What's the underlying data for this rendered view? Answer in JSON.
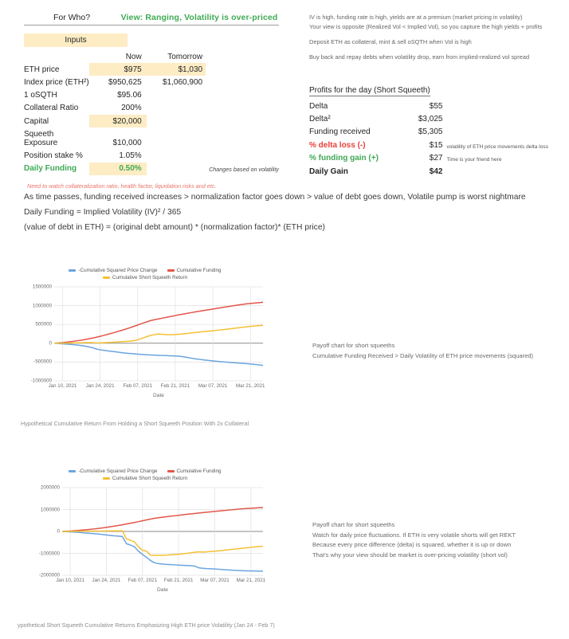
{
  "header": {
    "for_who": "For Who?",
    "view": "View: Ranging, Volatility is over-priced"
  },
  "inputs": {
    "badge": "Inputs",
    "col_now": "Now",
    "col_tomorrow": "Tomorrow",
    "rows": [
      {
        "label": "ETH price",
        "now": "$975",
        "tomorrow": "$1,030",
        "highlight": true
      },
      {
        "label": "Index price (ETH²)",
        "now": "$950,625",
        "tomorrow": "$1,060,900",
        "highlight": false
      },
      {
        "label": "1 oSQTH",
        "now": "$95.06",
        "tomorrow": "",
        "highlight": false
      },
      {
        "label": "Collateral Ratio",
        "now": "200%",
        "tomorrow": "",
        "highlight": false
      },
      {
        "label": "Capital",
        "now": "$20,000",
        "tomorrow": "",
        "highlight": true
      },
      {
        "label": "Squeeth Exposure",
        "now": "$10,000",
        "tomorrow": "",
        "highlight": false
      },
      {
        "label": "Position stake %",
        "now": "1.05%",
        "tomorrow": "",
        "highlight": false
      },
      {
        "label": "Daily Funding",
        "now": "0.50%",
        "tomorrow": "",
        "highlight": true,
        "note": "Changes based on volatility",
        "label_style": "green"
      }
    ],
    "warning": "Need to watch collateralization ratio, health factor, liquidation risks and etc."
  },
  "explainers": [
    "As time passes, funding received increases > normalization factor goes down > value of debt goes down, Volatile pump is worst nightmare",
    "Daily Funding = Implied Volatility (IV)² / 365",
    "(value of debt in ETH) = (original debt amount) * (normalization factor)* (ETH price)"
  ],
  "right_notes": [
    "IV is high, funding rate is high, yields are at a premium (market pricing in volatility)",
    "Your view is opposite (Realized Vol < Implied Vol), so you capture the high yields + profits",
    "Deposit ETH as collateral, mint & sell oSQTH when Vol is high",
    "Buy back and repay debts when volatility drop, earn from implied-realized vol spread"
  ],
  "profits": {
    "title": "Profits for the day (Short Squeeth)",
    "rows": [
      {
        "label": "Delta",
        "value": "$55",
        "style": "plain"
      },
      {
        "label": "Delta²",
        "value": "$3,025",
        "style": "plain"
      },
      {
        "label": "Funding received",
        "value": "$5,305",
        "style": "plain"
      },
      {
        "label": "% delta loss (-)",
        "value": "$15",
        "style": "red",
        "note": "volatility of ETH price movements delta loss"
      },
      {
        "label": "% funding gain (+)",
        "value": "$27",
        "style": "green",
        "note": "Time is your friend here"
      },
      {
        "label": "Daily Gain",
        "value": "$42",
        "style": "bold"
      }
    ]
  },
  "colors": {
    "series_squared_price": "#6aa4e0",
    "series_funding": "#e2564a",
    "series_short_return": "#f4c033",
    "highlight_fill": "#fdecc4",
    "green": "#3faa54",
    "red": "#e8403a"
  },
  "chart_data": [
    {
      "id": "chart1",
      "type": "line",
      "title": "",
      "caption": "Hypothetical Cumulative Return From Holding a Short Squeeth Position With 2x Collateral",
      "xlabel": "Date",
      "ylabel": "",
      "grid": true,
      "legend_position": "top",
      "ylim": [
        -1000000,
        1500000
      ],
      "yticks": [
        1500000,
        1000000,
        500000,
        0,
        -500000,
        -1000000
      ],
      "ytick_labels": [
        "1500000",
        "1000000",
        "500000",
        "0",
        "-500000",
        "-1000000"
      ],
      "xticks": [
        "Jan 10, 2021",
        "Jan 24, 2021",
        "Feb 07, 2021",
        "Feb 21, 2021",
        "Mar 07, 2021",
        "Mar 21, 2021"
      ],
      "series": [
        {
          "name": "-Cumulative Squared Price Change",
          "color": "#6aa4e0",
          "values": [
            0,
            -6000,
            -14000,
            -22000,
            -30000,
            -42000,
            -55000,
            -70000,
            -90000,
            -112000,
            -150000,
            -175000,
            -190000,
            -205000,
            -218000,
            -232000,
            -248000,
            -262000,
            -272000,
            -280000,
            -290000,
            -298000,
            -305000,
            -312000,
            -318000,
            -322000,
            -326000,
            -330000,
            -334000,
            -338000,
            -345000,
            -360000,
            -380000,
            -400000,
            -418000,
            -432000,
            -446000,
            -458000,
            -470000,
            -482000,
            -492000,
            -500000,
            -510000,
            -518000,
            -526000,
            -534000,
            -542000,
            -552000,
            -562000,
            -575000,
            -590000
          ]
        },
        {
          "name": "Cumulative Funding",
          "color": "#e2564a",
          "values": [
            0,
            8000,
            18000,
            30000,
            44000,
            58000,
            74000,
            92000,
            112000,
            134000,
            158000,
            184000,
            212000,
            242000,
            272000,
            304000,
            338000,
            372000,
            408000,
            446000,
            486000,
            524000,
            562000,
            600000,
            626000,
            648000,
            670000,
            692000,
            714000,
            736000,
            758000,
            778000,
            798000,
            818000,
            838000,
            856000,
            874000,
            892000,
            910000,
            928000,
            946000,
            964000,
            982000,
            1000000,
            1016000,
            1032000,
            1046000,
            1058000,
            1068000,
            1078000,
            1090000
          ]
        },
        {
          "name": "Cumulative Short Squeeth Return",
          "color": "#f4c033",
          "values": [
            0,
            2000,
            4000,
            6000,
            8000,
            10000,
            12000,
            14000,
            16000,
            18000,
            10000,
            8000,
            14000,
            20000,
            26000,
            32000,
            40000,
            48000,
            56000,
            64000,
            90000,
            130000,
            170000,
            205000,
            230000,
            245000,
            238000,
            230000,
            226000,
            232000,
            240000,
            250000,
            262000,
            276000,
            290000,
            300000,
            312000,
            322000,
            332000,
            344000,
            356000,
            368000,
            382000,
            396000,
            410000,
            424000,
            436000,
            448000,
            458000,
            468000,
            478000
          ]
        }
      ]
    },
    {
      "id": "chart2",
      "type": "line",
      "title": "",
      "caption": "ypothetical Short Squeeth Cumulative Returns Emphasizing High ETH price Volatility (Jan 24 - Feb 7)",
      "xlabel": "Date",
      "ylabel": "",
      "grid": true,
      "legend_position": "top",
      "ylim": [
        -2000000,
        2000000
      ],
      "yticks": [
        2000000,
        1000000,
        0,
        -1000000,
        -2000000
      ],
      "ytick_labels": [
        "2000000",
        "1000000",
        "0",
        "-1000000",
        "-2000000"
      ],
      "xticks": [
        "Jan 10, 2021",
        "Jan 24, 2021",
        "Feb 07, 2021",
        "Feb 21, 2021",
        "Mar 07, 2021",
        "Mar 21, 2021"
      ],
      "series": [
        {
          "name": "-Cumulative Squared Price Change",
          "color": "#6aa4e0",
          "values": [
            0,
            -8000,
            -18000,
            -30000,
            -42000,
            -58000,
            -72000,
            -88000,
            -104000,
            -120000,
            -140000,
            -160000,
            -180000,
            -200000,
            -215000,
            -230000,
            -560000,
            -620000,
            -700000,
            -900000,
            -1050000,
            -1180000,
            -1330000,
            -1430000,
            -1470000,
            -1490000,
            -1505000,
            -1515000,
            -1525000,
            -1535000,
            -1545000,
            -1555000,
            -1565000,
            -1580000,
            -1660000,
            -1680000,
            -1695000,
            -1705000,
            -1715000,
            -1725000,
            -1740000,
            -1755000,
            -1765000,
            -1775000,
            -1785000,
            -1792000,
            -1798000,
            -1802000,
            -1806000,
            -1810000,
            -1815000
          ]
        },
        {
          "name": "Cumulative Funding",
          "color": "#e2564a",
          "values": [
            0,
            9000,
            20000,
            33000,
            47000,
            62000,
            78000,
            96000,
            116000,
            138000,
            160000,
            186000,
            214000,
            244000,
            274000,
            306000,
            340000,
            374000,
            410000,
            448000,
            488000,
            526000,
            564000,
            602000,
            628000,
            650000,
            672000,
            694000,
            716000,
            738000,
            760000,
            780000,
            800000,
            820000,
            840000,
            858000,
            876000,
            894000,
            912000,
            930000,
            948000,
            966000,
            984000,
            1002000,
            1018000,
            1034000,
            1048000,
            1060000,
            1070000,
            1080000,
            1092000
          ]
        },
        {
          "name": "Cumulative Short Squeeth Return",
          "color": "#f4c033",
          "values": [
            0,
            2000,
            4000,
            6000,
            8000,
            10000,
            12000,
            14000,
            16000,
            18000,
            20000,
            22000,
            24000,
            26000,
            28000,
            30000,
            -340000,
            -400000,
            -480000,
            -700000,
            -860000,
            -900000,
            -1085000,
            -1095000,
            -1090000,
            -1085000,
            -1080000,
            -1070000,
            -1055000,
            -1040000,
            -1020000,
            -1000000,
            -975000,
            -950000,
            -930000,
            -940000,
            -930000,
            -915000,
            -900000,
            -885000,
            -865000,
            -845000,
            -825000,
            -805000,
            -785000,
            -765000,
            -745000,
            -725000,
            -705000,
            -690000,
            -675000
          ]
        }
      ]
    }
  ],
  "chart_notes": [
    {
      "lines": [
        "Payoff chart for short squeeths",
        "Cumulative Funding Received > Daily Volatility of ETH price movements (squared)"
      ]
    },
    {
      "lines": [
        "Payoff chart for short squeeths",
        "Watch for daily price fluctuations. If ETH is very volatile shorts will get REKT",
        "Because every price difference (delta) is squared, whether it is up or down",
        "That's why your view should be market is over-pricing volatility (short vol)"
      ]
    }
  ]
}
